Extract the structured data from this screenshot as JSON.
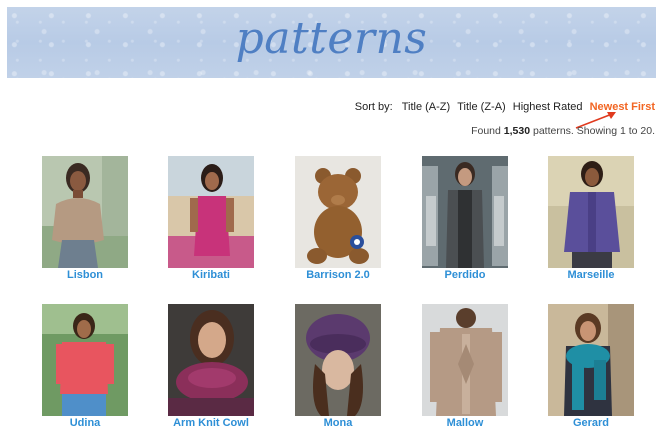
{
  "banner": {
    "title": "patterns"
  },
  "sort": {
    "label": "Sort by:",
    "options": [
      "Title (A-Z)",
      "Title (Z-A)",
      "Highest Rated",
      "Newest First"
    ],
    "active": "Newest First",
    "active_color": "#f26522"
  },
  "results": {
    "prefix": "Found ",
    "count": "1,530",
    "suffix": " patterns. Showing 1 to 20."
  },
  "link_color": "#2e8fd6",
  "patterns": [
    {
      "name": "Lisbon"
    },
    {
      "name": "Kiribati"
    },
    {
      "name": "Barrison 2.0"
    },
    {
      "name": "Perdido"
    },
    {
      "name": "Marseille"
    },
    {
      "name": "Udina"
    },
    {
      "name": "Arm Knit Cowl"
    },
    {
      "name": "Mona"
    },
    {
      "name": "Mallow"
    },
    {
      "name": "Gerard"
    }
  ]
}
